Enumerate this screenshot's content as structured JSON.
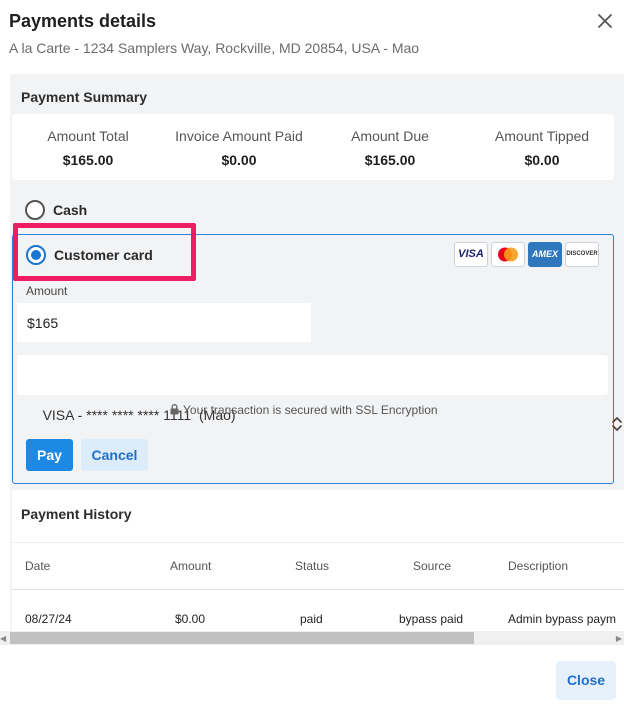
{
  "dialog": {
    "title": "Payments details",
    "subtitle": "A la Carte - 1234 Samplers Way, Rockville, MD 20854, USA - Mao"
  },
  "summary": {
    "title": "Payment Summary",
    "columns": [
      {
        "label": "Amount Total",
        "value": "$165.00"
      },
      {
        "label": "Invoice Amount Paid",
        "value": "$0.00"
      },
      {
        "label": "Amount Due",
        "value": "$165.00"
      },
      {
        "label": "Amount Tipped",
        "value": "$0.00"
      }
    ]
  },
  "payment_methods": {
    "cash_label": "Cash",
    "card_label": "Customer card",
    "selected": "Customer card"
  },
  "card_logos": [
    {
      "name": "visa-logo",
      "text": "VISA",
      "color": "#1a1f71"
    },
    {
      "name": "mastercard-logo",
      "text": "",
      "color": "#eb001b"
    },
    {
      "name": "amex-logo",
      "text": "AMEX",
      "color": "#2e77bc"
    },
    {
      "name": "discover-logo",
      "text": "DISCOVER",
      "color": "#333333"
    }
  ],
  "form": {
    "amount_label": "Amount",
    "amount_value": "$165",
    "card_selected": "VISA - **** **** **** 1111  (Mao)",
    "ssl_text": "Your transaction is secured with SSL Encryption",
    "pay_label": "Pay",
    "cancel_label": "Cancel"
  },
  "history": {
    "title": "Payment History",
    "columns": [
      "Date",
      "Amount",
      "Status",
      "Source",
      "Description"
    ],
    "rows": [
      [
        "08/27/24",
        "$0.00",
        "paid",
        "bypass paid",
        "Admin bypass paym"
      ]
    ]
  },
  "footer": {
    "close_label": "Close"
  },
  "colors": {
    "accent": "#1e88e5",
    "highlight": "#ee1c63"
  }
}
